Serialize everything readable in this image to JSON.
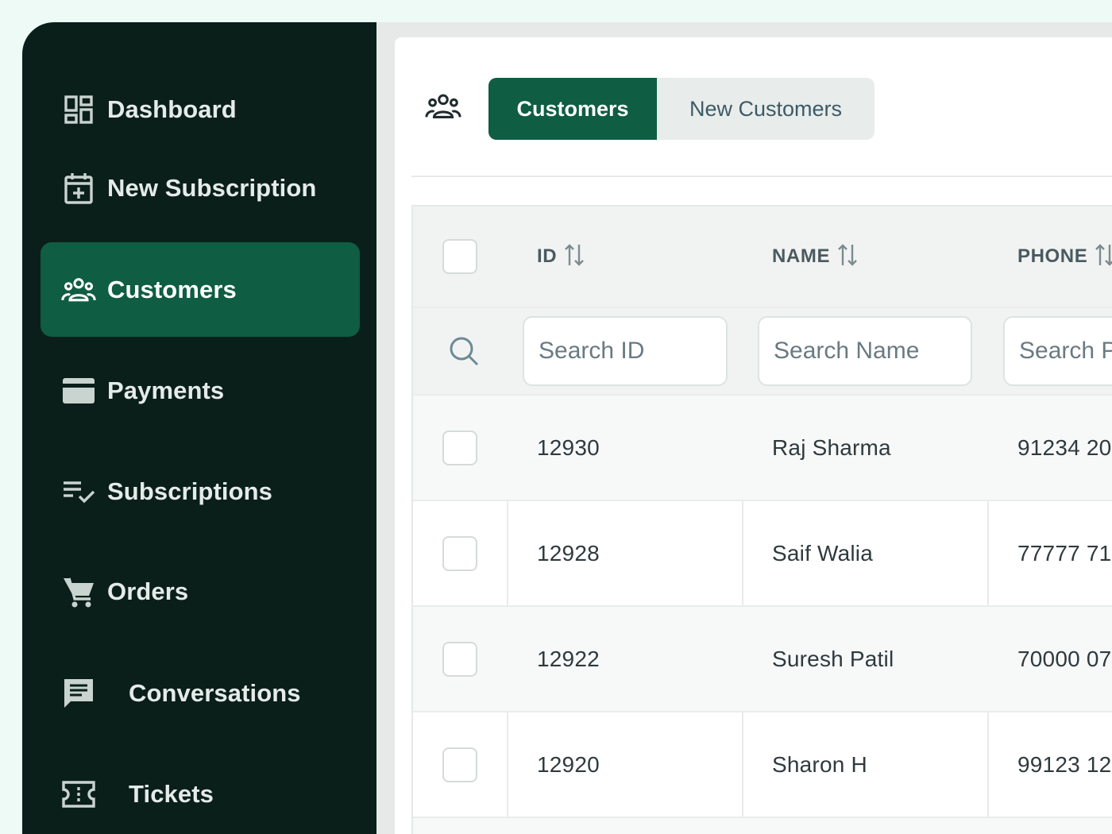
{
  "sidebar": {
    "items": [
      {
        "label": "Dashboard",
        "icon": "dashboard-icon",
        "active": false
      },
      {
        "label": "New Subscription",
        "icon": "calendar-plus-icon",
        "active": false
      },
      {
        "label": "Customers",
        "icon": "users-icon",
        "active": true
      },
      {
        "label": "Payments",
        "icon": "credit-card-icon",
        "active": false
      },
      {
        "label": "Subscriptions",
        "icon": "checklist-icon",
        "active": false
      },
      {
        "label": "Orders",
        "icon": "cart-icon",
        "active": false
      },
      {
        "label": "Conversations",
        "icon": "chat-icon",
        "active": false
      },
      {
        "label": "Tickets",
        "icon": "ticket-icon",
        "active": false
      }
    ]
  },
  "header": {
    "icon": "users-icon",
    "tabs": [
      {
        "label": "Customers",
        "active": true
      },
      {
        "label": "New Customers",
        "active": false
      }
    ]
  },
  "table": {
    "columns": [
      {
        "label": "ID",
        "placeholder": "Search ID"
      },
      {
        "label": "NAME",
        "placeholder": "Search Name"
      },
      {
        "label": "PHONE",
        "placeholder": "Search Phone"
      }
    ],
    "rows": [
      {
        "id": "12930",
        "name": "Raj Sharma",
        "phone": "91234 20"
      },
      {
        "id": "12928",
        "name": "Saif Walia",
        "phone": "77777 71"
      },
      {
        "id": "12922",
        "name": "Suresh Patil",
        "phone": "70000 07"
      },
      {
        "id": "12920",
        "name": "Sharon H",
        "phone": "99123 12"
      }
    ]
  },
  "colors": {
    "sidebar_bg": "#0b1f1a",
    "accent": "#0f5d42",
    "page_bg": "#eefaf5"
  }
}
